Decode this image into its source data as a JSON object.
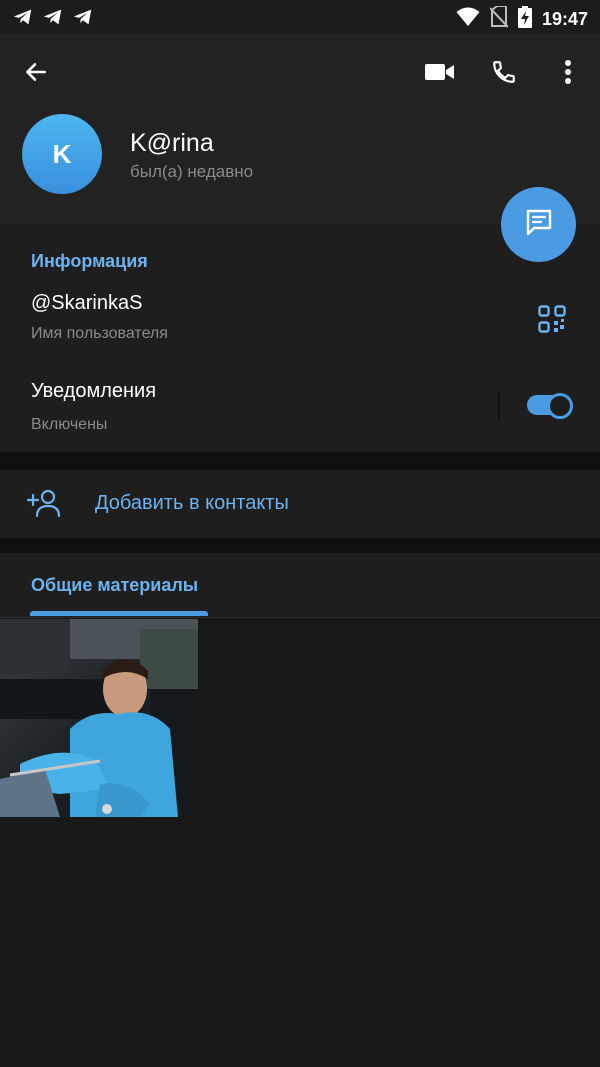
{
  "status_bar": {
    "time": "19:47",
    "left_icons": [
      "telegram-icon",
      "telegram-icon",
      "telegram-icon"
    ],
    "right_icons": [
      "wifi-icon",
      "no-sim-icon",
      "battery-charging-icon"
    ]
  },
  "toolbar": {
    "back_icon": "arrow-left-icon",
    "video_call_icon": "video-camera-icon",
    "call_icon": "phone-icon",
    "more_icon": "more-vertical-icon"
  },
  "profile": {
    "avatar_letter": "K",
    "name": "K@rina",
    "status": "был(а) недавно",
    "avatar_colors": [
      "#4db6f0",
      "#3a8fdc"
    ]
  },
  "fab": {
    "icon": "message-icon"
  },
  "info": {
    "heading": "Информация",
    "username": "@SkarinkaS",
    "username_caption": "Имя пользователя",
    "notifications_label": "Уведомления",
    "notifications_state": "Включены",
    "notifications_enabled": true,
    "qr_icon": "qr-code-icon"
  },
  "add_contact": {
    "label": "Добавить в контакты",
    "icon": "add-person-icon"
  },
  "shared_media": {
    "tab_label": "Общие материалы",
    "items_count": 1
  },
  "theme": {
    "accent": "#4a9be2",
    "accent_text": "#6cb2ee",
    "background": "#181818",
    "header": "#222222",
    "panel": "#1e1e1e"
  }
}
